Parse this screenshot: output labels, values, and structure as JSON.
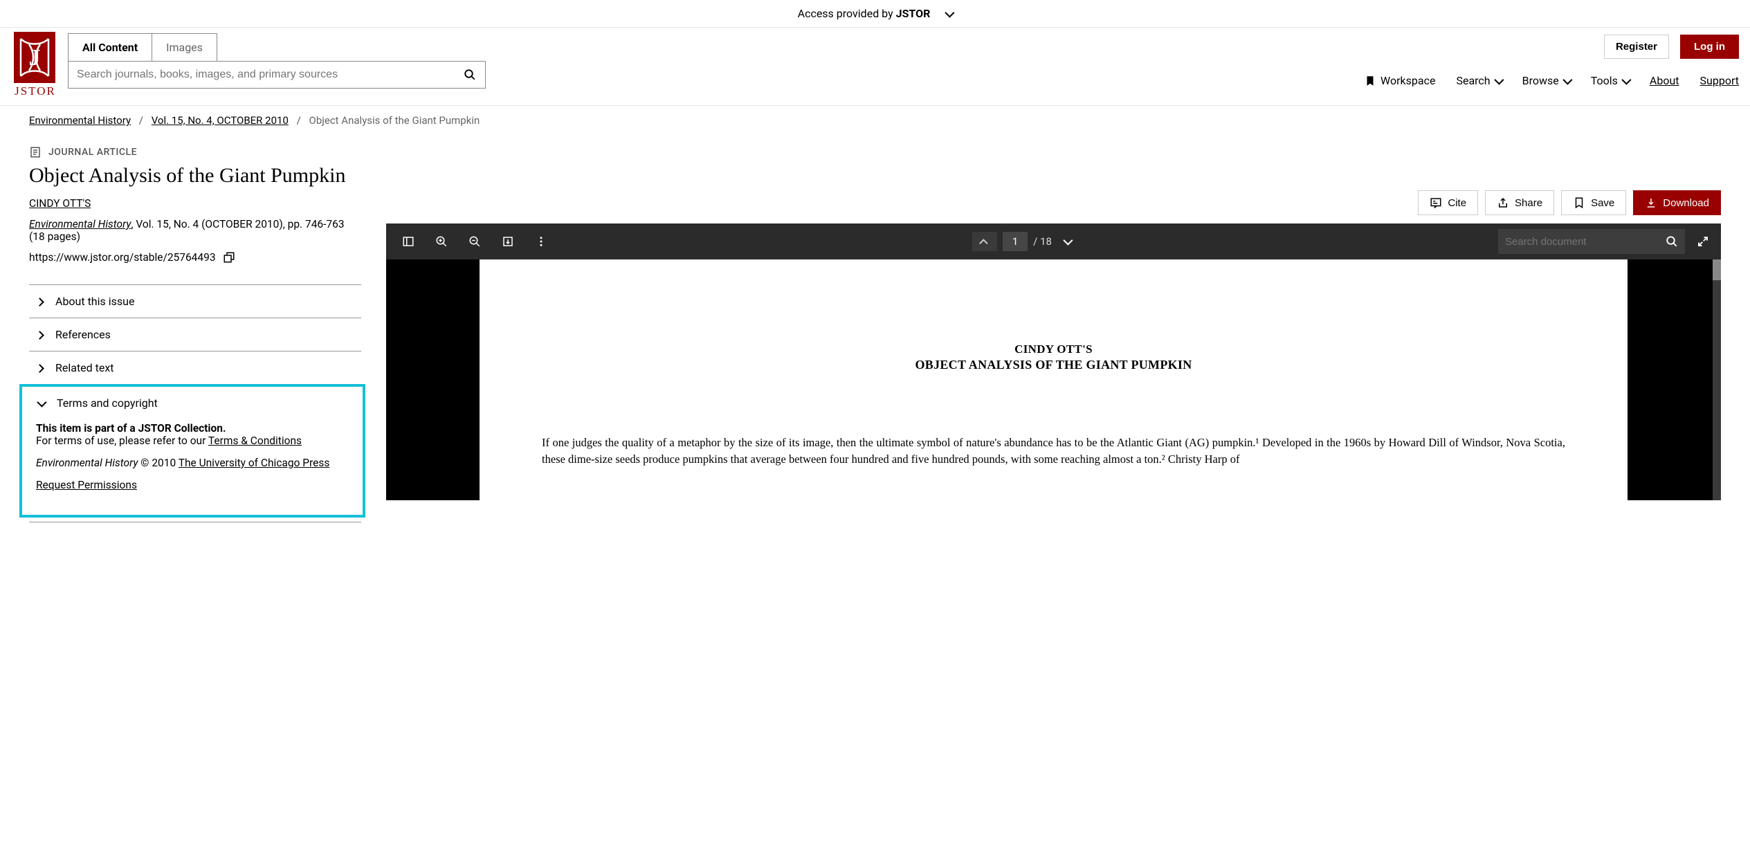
{
  "access_bar": {
    "prefix": "Access provided by ",
    "provider": "JSTOR"
  },
  "logo_text": "JSTOR",
  "search_tabs": {
    "all": "All Content",
    "images": "Images"
  },
  "search_placeholder": "Search journals, books, images, and primary sources",
  "auth": {
    "register": "Register",
    "login": "Log in"
  },
  "nav": {
    "workspace": "Workspace",
    "search": "Search",
    "browse": "Browse",
    "tools": "Tools",
    "about": "About",
    "support": "Support"
  },
  "breadcrumb": {
    "journal": "Environmental History",
    "issue": "Vol. 15, No. 4, OCTOBER 2010",
    "current": "Object Analysis of the Giant Pumpkin"
  },
  "article": {
    "type_label": "JOURNAL ARTICLE",
    "title": "Object Analysis of the Giant Pumpkin",
    "author": "CINDY OTT'S",
    "journal_name": "Environmental History",
    "citation_rest": ", Vol. 15, No. 4 (OCTOBER 2010), pp. 746-763 (18 pages)",
    "stable_url": "https://www.jstor.org/stable/25764493"
  },
  "actions": {
    "cite": "Cite",
    "share": "Share",
    "save": "Save",
    "download": "Download"
  },
  "accordion": {
    "about": "About this issue",
    "references": "References",
    "related": "Related text",
    "terms": "Terms and copyright"
  },
  "terms_panel": {
    "heading": "This item is part of a JSTOR Collection.",
    "line1_pre": "For terms of use, please refer to our ",
    "tac": "Terms & Conditions",
    "journal_em": "Environmental History",
    "copyright_mid": " © 2010 ",
    "publisher": "The University of Chicago Press",
    "request": "Request Permissions"
  },
  "viewer": {
    "page_current": "1",
    "page_total": "/ 18",
    "search_placeholder": "Search document",
    "doc_author": "CINDY OTT'S",
    "doc_title": "OBJECT ANALYSIS OF THE GIANT PUMPKIN",
    "doc_body": "If one judges the quality of a metaphor by the size of its image, then the ultimate symbol of nature's abundance has to be the Atlantic Giant (AG) pumpkin.¹ Developed in the 1960s by Howard Dill of Windsor, Nova Scotia, these dime-size seeds produce pumpkins that average between four hundred and five hundred pounds, with some reaching almost a ton.² Christy Harp of"
  }
}
